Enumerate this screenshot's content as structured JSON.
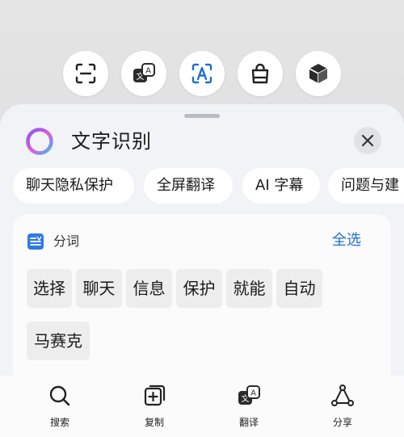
{
  "top_tools": [
    {
      "name": "scan",
      "icon": "scan-icon"
    },
    {
      "name": "translate",
      "icon": "translate-icon"
    },
    {
      "name": "text-recognition",
      "icon": "text-recognition-icon"
    },
    {
      "name": "shopping",
      "icon": "shopping-bag-icon"
    },
    {
      "name": "cube",
      "icon": "cube-icon"
    }
  ],
  "sheet": {
    "title": "文字识别",
    "close_icon": "close-icon",
    "chips": [
      "聊天隐私保护",
      "全屏翻译",
      "AI 字幕",
      "问题与建"
    ],
    "card": {
      "icon": "document-text-icon",
      "title": "分词",
      "select_all": "全选",
      "words": [
        "选择",
        "聊天",
        "信息",
        "保护",
        "就能",
        "自动",
        "马赛克"
      ]
    },
    "actions": [
      {
        "label": "搜索",
        "icon": "search-icon"
      },
      {
        "label": "复制",
        "icon": "copy-icon"
      },
      {
        "label": "翻译",
        "icon": "translate-icon"
      },
      {
        "label": "分享",
        "icon": "share-icon"
      }
    ]
  },
  "colors": {
    "accent": "#1f6fd0",
    "background": "#e0e0e0",
    "sheet": "#f1f3f6",
    "chip": "#ffffff"
  }
}
